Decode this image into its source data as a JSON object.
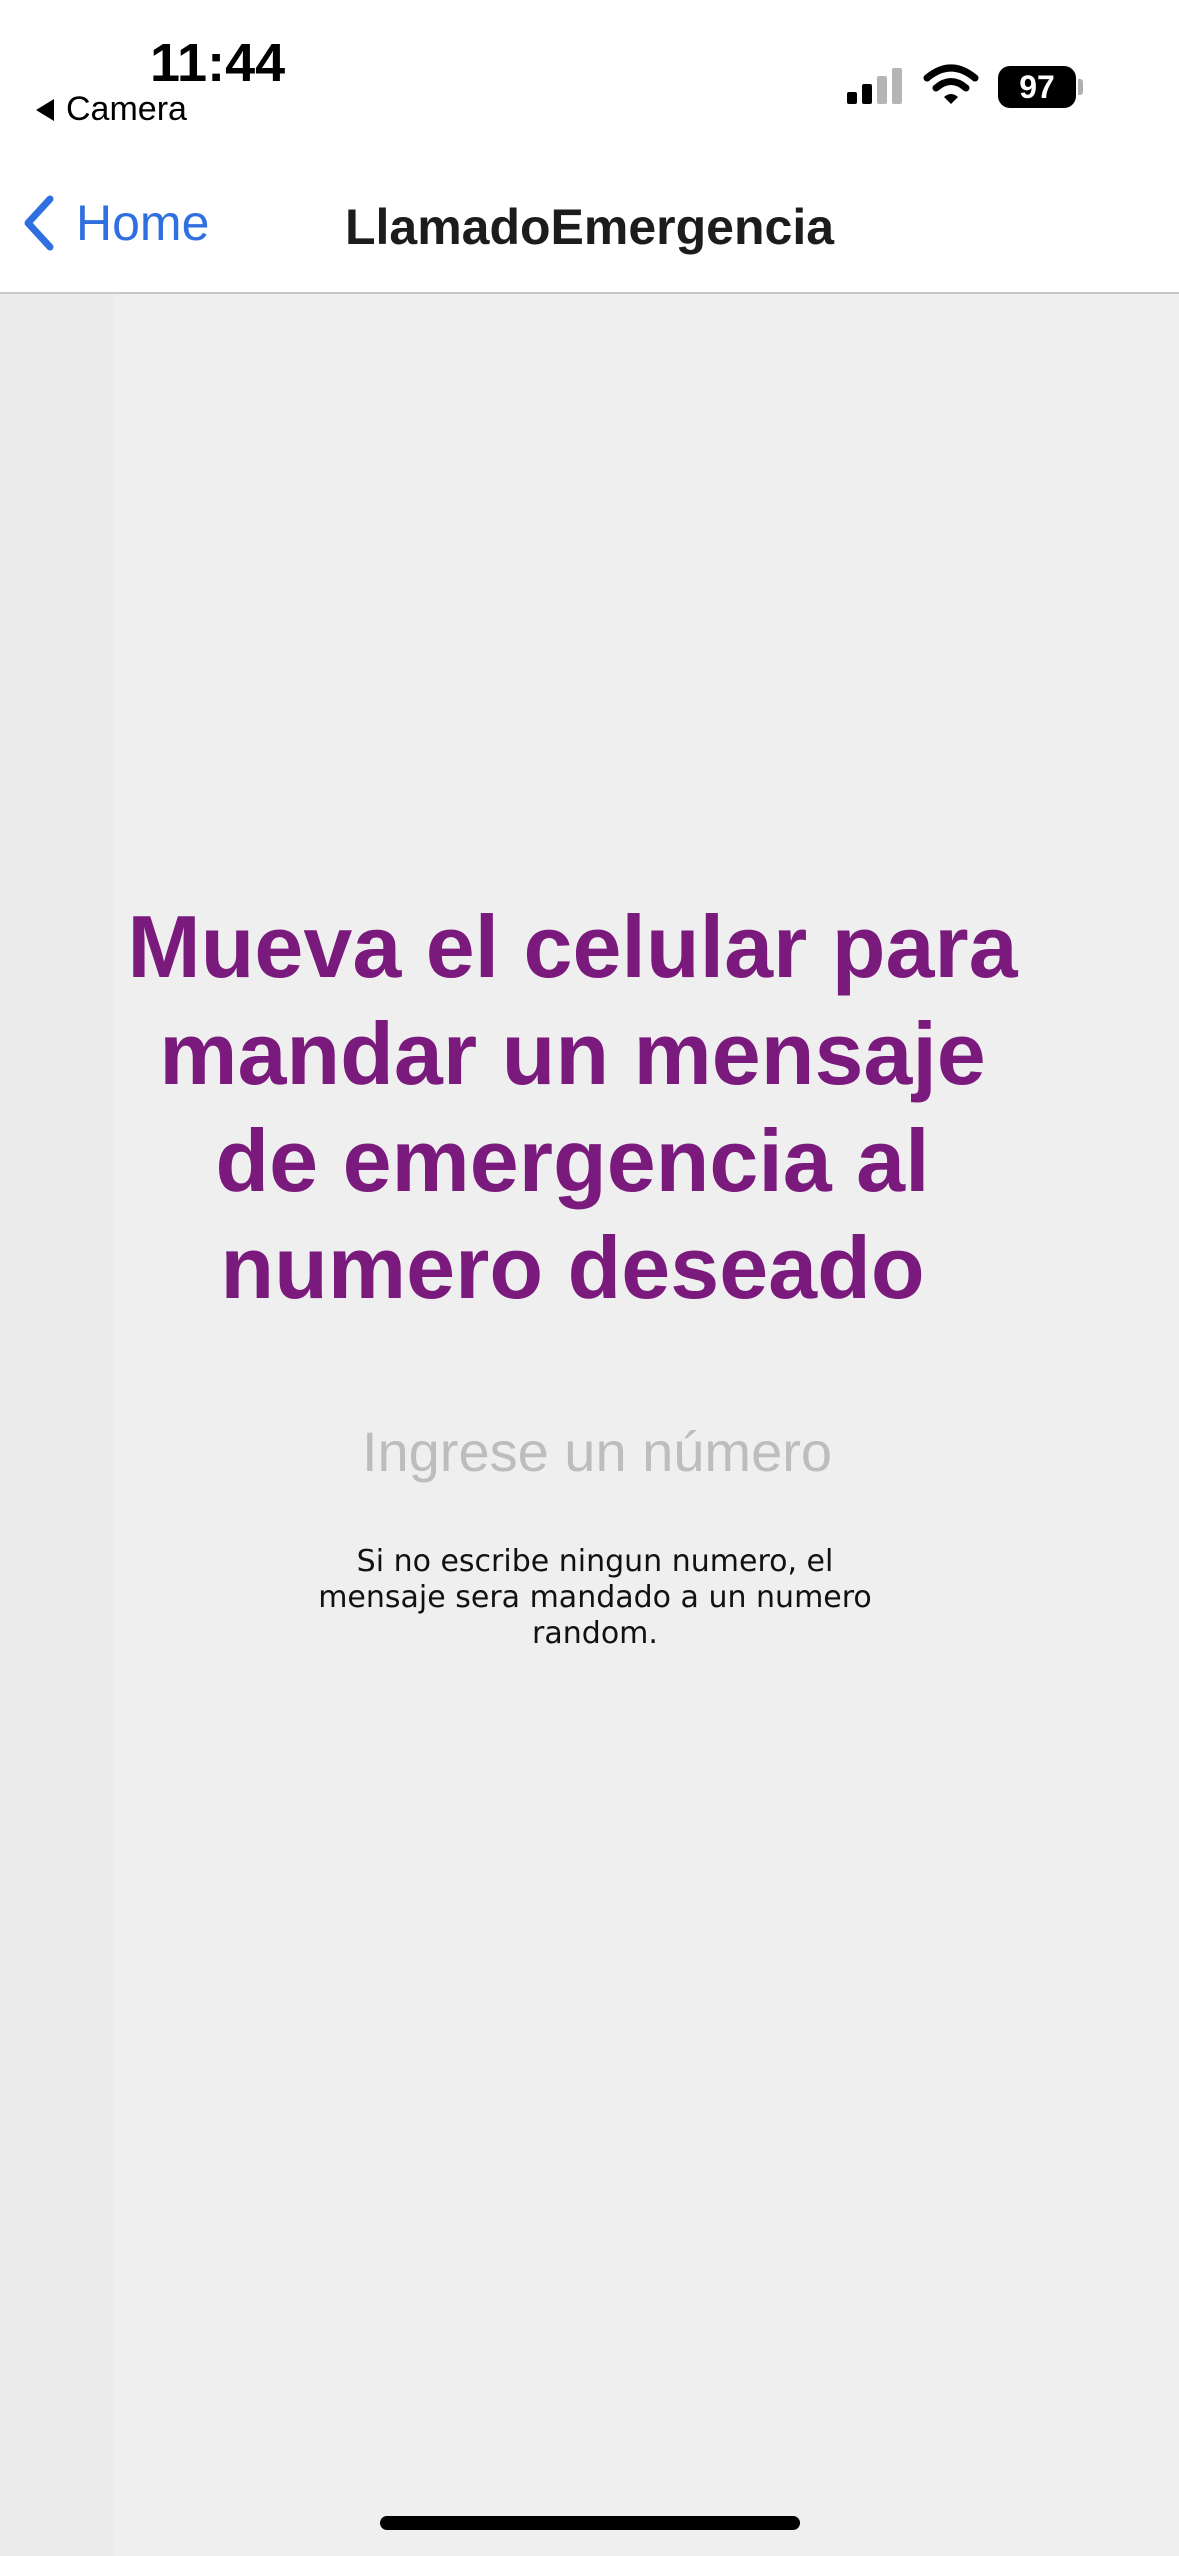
{
  "status_bar": {
    "time": "11:44",
    "back_app_label": "Camera",
    "battery_level": "97",
    "signal_icon": "cellular-signal-icon",
    "wifi_icon": "wifi-icon"
  },
  "nav": {
    "back_label": "Home",
    "title": "LlamadoEmergencia",
    "back_icon": "chevron-left-icon"
  },
  "main": {
    "headline": "Mueva el celular para mandar un mensaje de emergencia al numero deseado",
    "number_input": {
      "value": "",
      "placeholder": "Ingrese un número"
    },
    "helper_text": "Si no escribe ningun numero, el mensaje sera mandado a un numero random."
  },
  "colors": {
    "accent": "#2f6fe0",
    "headline": "#7a1a7d",
    "background": "#efefef"
  }
}
